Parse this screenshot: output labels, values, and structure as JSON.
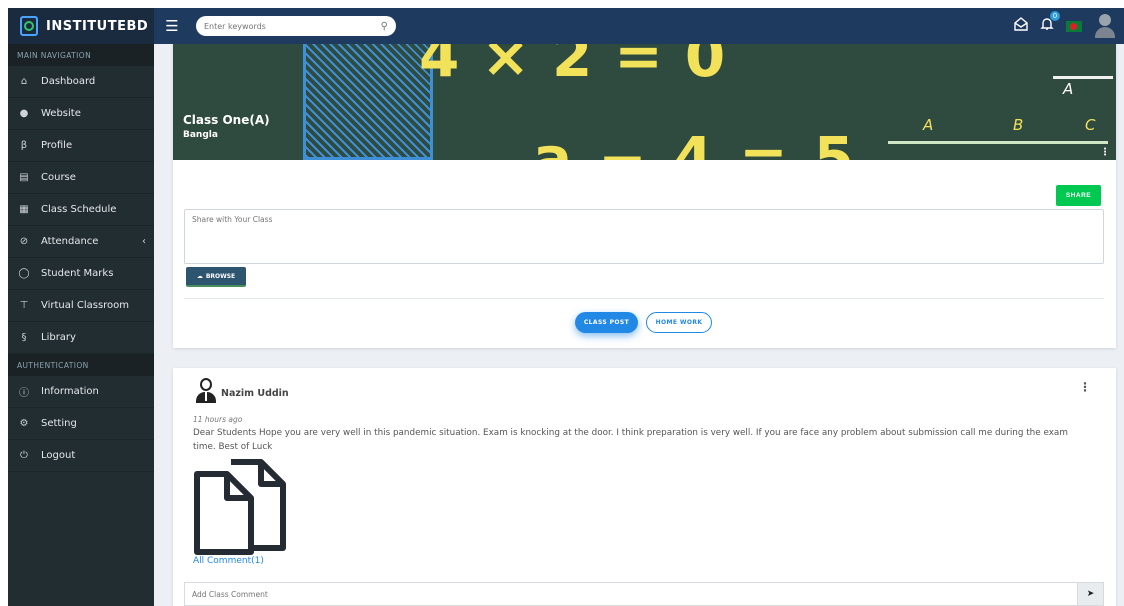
{
  "brand": {
    "name": "INSTITUTEBD"
  },
  "topbar": {
    "search_placeholder": "Enter keywords",
    "notification_count": "0",
    "icons": [
      "menu-icon",
      "search-icon",
      "mail-icon",
      "bell-icon",
      "flag-icon",
      "user-avatar"
    ]
  },
  "sidebar": {
    "sections": [
      {
        "header": "MAIN NAVIGATION",
        "items": [
          {
            "label": "Dashboard",
            "icon": "home-icon"
          },
          {
            "label": "Website",
            "icon": "globe-icon"
          },
          {
            "label": "Profile",
            "icon": "profile-icon"
          },
          {
            "label": "Course",
            "icon": "book-icon"
          },
          {
            "label": "Class Schedule",
            "icon": "calendar-icon"
          },
          {
            "label": "Attendance",
            "icon": "check-circle-icon",
            "has_submenu": true
          },
          {
            "label": "Student Marks",
            "icon": "bulb-icon"
          },
          {
            "label": "Virtual Classroom",
            "icon": "podium-icon"
          },
          {
            "label": "Library",
            "icon": "library-icon"
          }
        ]
      },
      {
        "header": "AUTHENTICATION",
        "items": [
          {
            "label": "Information",
            "icon": "info-icon"
          },
          {
            "label": "Setting",
            "icon": "gear-icon"
          },
          {
            "label": "Logout",
            "icon": "power-icon"
          }
        ]
      }
    ]
  },
  "class_banner": {
    "title": "Class One(A)",
    "subject": "Bangla",
    "board_labels": [
      "A",
      "B",
      "C",
      "A"
    ]
  },
  "composer": {
    "share_label": "SHARE",
    "textarea_placeholder": "Share with Your Class",
    "browse_label": "BROWSE",
    "tabs": [
      {
        "label": "CLASS POST",
        "active": true
      },
      {
        "label": "HOME WORK",
        "active": false
      }
    ]
  },
  "post": {
    "author": "Nazim Uddin",
    "time": "11 hours ago",
    "body": "Dear Students Hope you are very well in this pandemic situation. Exam is knocking at the door. I think preparation is very well. If you are face any problem about submission call me during the exam time. Best of Luck",
    "attachment_icon": "documents-icon",
    "comments_link": "All Comment(1)",
    "comment_placeholder": "Add Class Comment"
  },
  "colors": {
    "topbar": "#1e3a5f",
    "sidebar": "#222d32",
    "accent": "#2188e6",
    "share": "#00c851",
    "board": "#2f4a3e",
    "chalk": "#f2e25a"
  }
}
